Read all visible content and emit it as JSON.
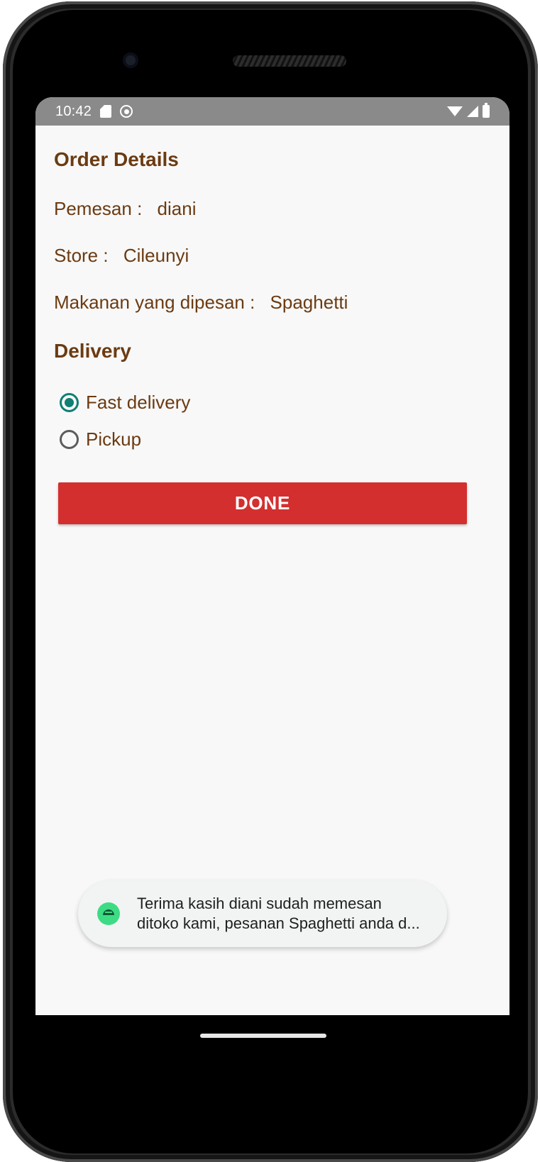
{
  "status_bar": {
    "time": "10:42",
    "icons": [
      "sim-card-icon",
      "settings-gear-icon",
      "wifi-icon",
      "cell-signal-icon",
      "battery-icon"
    ]
  },
  "order_details": {
    "title": "Order Details",
    "pemesan_label": "Pemesan :",
    "pemesan_value": "diani",
    "store_label": "Store :",
    "store_value": "Cileunyi",
    "makanan_label": "Makanan yang dipesan :",
    "makanan_value": "Spaghetti"
  },
  "delivery": {
    "title": "Delivery",
    "options": [
      {
        "label": "Fast delivery",
        "selected": true
      },
      {
        "label": "Pickup",
        "selected": false
      }
    ]
  },
  "done_button": {
    "label": "DONE",
    "color": "#d32f2f"
  },
  "toast": {
    "icon": "android-icon",
    "line1": "Terima kasih diani sudah memesan",
    "line2": "ditoko kami, pesanan Spaghetti anda d..."
  },
  "colors": {
    "text_brown": "#6b3b12",
    "radio_teal": "#0f7f73",
    "status_bar_bg": "#8a8a8a",
    "screen_bg": "#f8f8f8"
  }
}
